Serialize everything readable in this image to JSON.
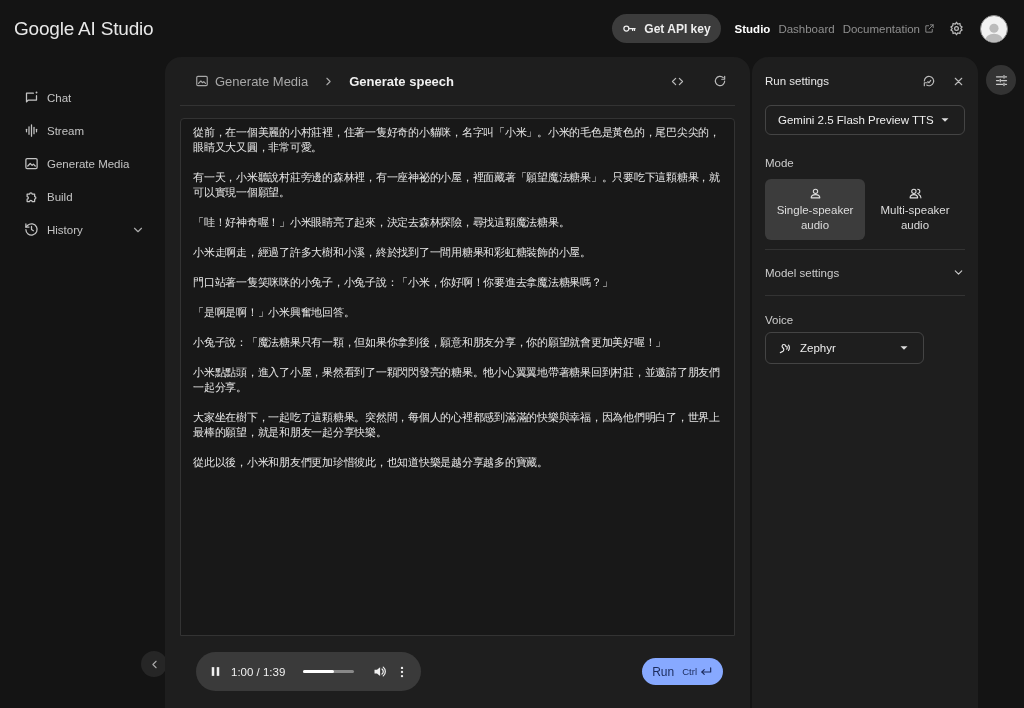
{
  "header": {
    "logo": "Google AI Studio",
    "api_key_button": "Get API key",
    "nav_links": [
      {
        "label": "Studio",
        "selected": true,
        "external": false
      },
      {
        "label": "Dashboard",
        "selected": false,
        "external": false
      },
      {
        "label": "Documentation",
        "selected": false,
        "external": true
      }
    ]
  },
  "sidebar": {
    "items": [
      {
        "label": "Chat",
        "expandable": false
      },
      {
        "label": "Stream",
        "expandable": false
      },
      {
        "label": "Generate Media",
        "expandable": false
      },
      {
        "label": "Build",
        "expandable": false
      },
      {
        "label": "History",
        "expandable": true,
        "expanded": false
      }
    ]
  },
  "editor": {
    "breadcrumb": [
      "Generate Media",
      "Generate speech"
    ],
    "paragraphs": [
      "從前，在一個美麗的小村莊裡，住著一隻好奇的小貓咪，名字叫「小米」。小米的毛色是黃色的，尾巴尖尖的，眼睛又大又圓，非常可愛。",
      "有一天，小米聽說村莊旁邊的森林裡，有一座神祕的小屋，裡面藏著「願望魔法糖果」。只要吃下這顆糖果，就可以實現一個願望。",
      "「哇！好神奇喔！」小米眼睛亮了起來，決定去森林探險，尋找這顆魔法糖果。",
      "小米走啊走，經過了許多大樹和小溪，終於找到了一間用糖果和彩虹糖裝飾的小屋。",
      "門口站著一隻笑咪咪的小兔子，小兔子說：「小米，你好啊！你要進去拿魔法糖果嗎？」",
      "「是啊是啊！」小米興奮地回答。",
      "小兔子說：「魔法糖果只有一顆，但如果你拿到後，願意和朋友分享，你的願望就會更加美好喔！」",
      "小米點點頭，進入了小屋，果然看到了一顆閃閃發亮的糖果。牠小心翼翼地帶著糖果回到村莊，並邀請了朋友們一起分享。",
      "大家坐在樹下，一起吃了這顆糖果。突然間，每個人的心裡都感到滿滿的快樂與幸福，因為他們明白了，世界上最棒的願望，就是和朋友一起分享快樂。",
      "從此以後，小米和朋友們更加珍惜彼此，也知道快樂是越分享越多的寶藏。"
    ],
    "player": {
      "playing": true,
      "time": "1:00 / 1:39",
      "level": 0.6
    },
    "run_button": {
      "label": "Run",
      "shortcut": "Ctrl"
    }
  },
  "run_settings": {
    "title": "Run settings",
    "model": "Gemini 2.5 Flash Preview TTS",
    "mode_label": "Mode",
    "modes": [
      {
        "label": "Single-speaker audio",
        "selected": true
      },
      {
        "label": "Multi-speaker audio",
        "selected": false
      }
    ],
    "model_settings": {
      "label": "Model settings",
      "expanded": false
    },
    "voice_label": "Voice",
    "voice": "Zephyr"
  }
}
